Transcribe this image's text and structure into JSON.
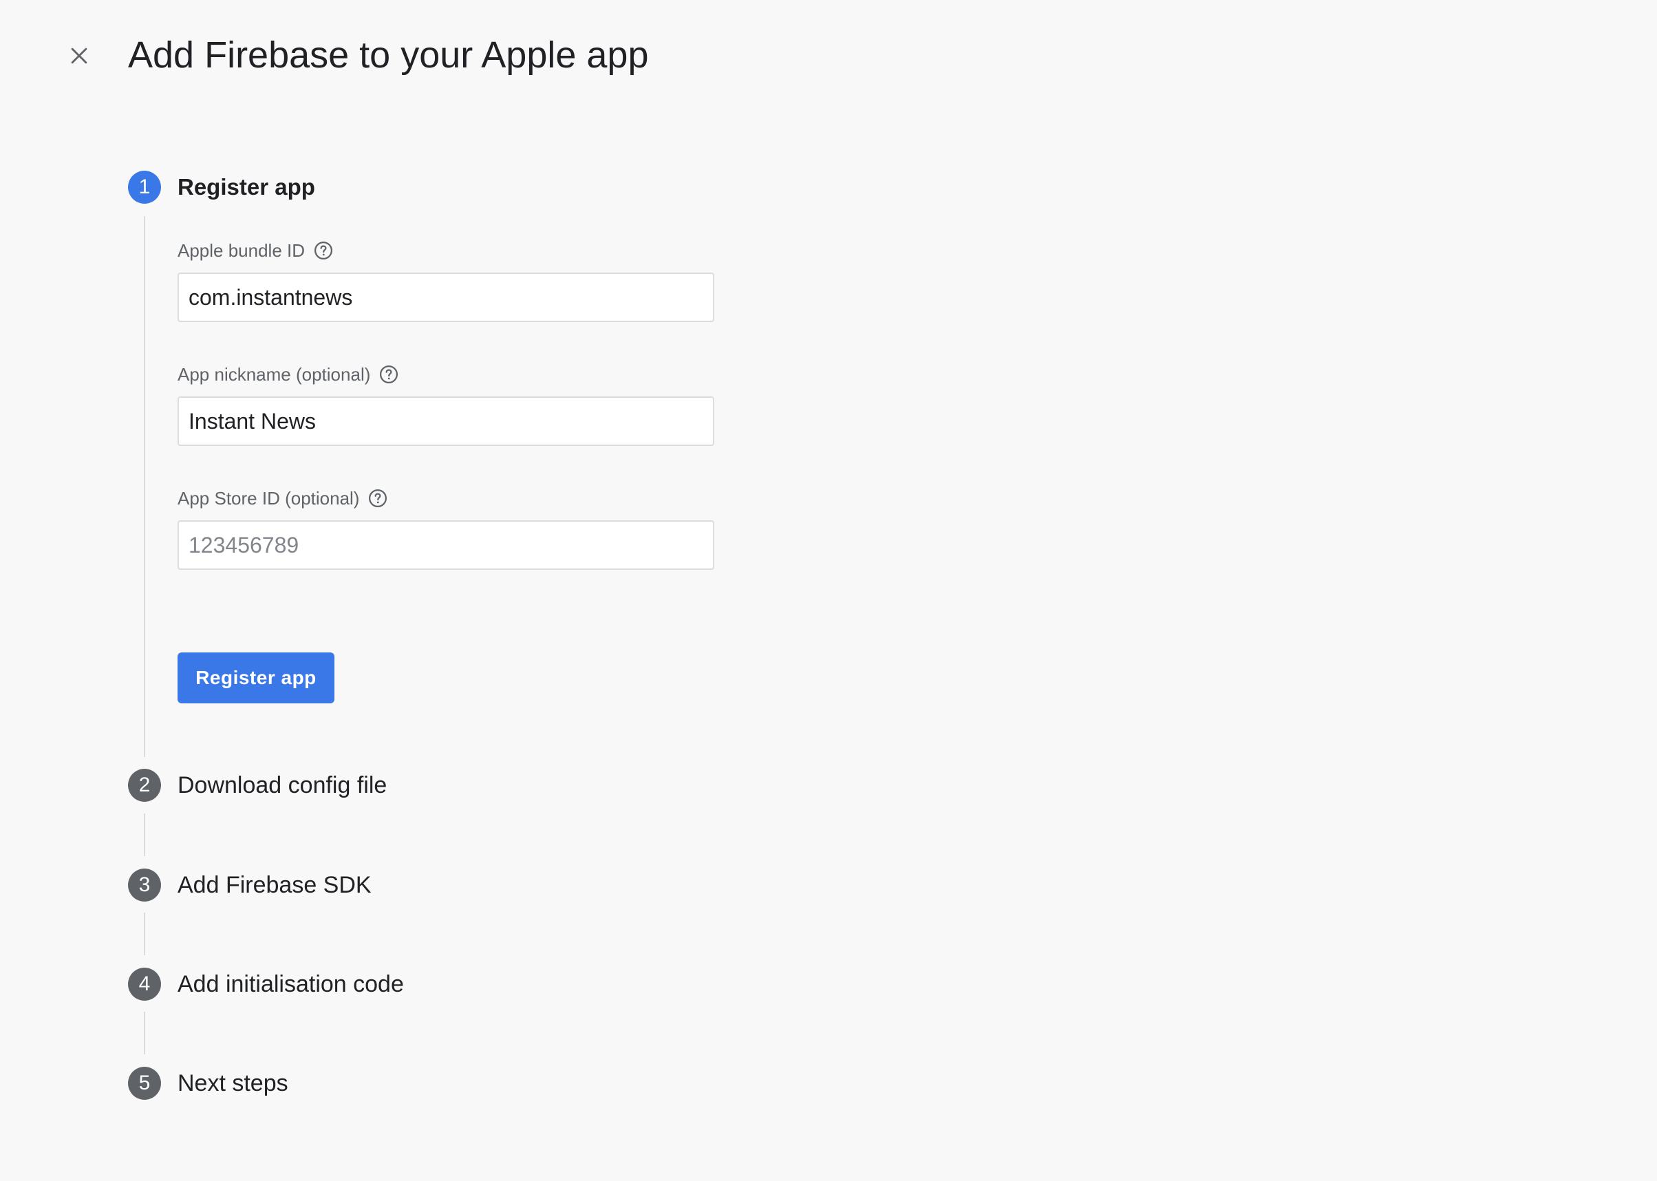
{
  "header": {
    "title": "Add Firebase to your Apple app"
  },
  "steps": [
    {
      "number": "1",
      "label": "Register app",
      "active": true
    },
    {
      "number": "2",
      "label": "Download config file",
      "active": false
    },
    {
      "number": "3",
      "label": "Add Firebase SDK",
      "active": false
    },
    {
      "number": "4",
      "label": "Add initialisation code",
      "active": false
    },
    {
      "number": "5",
      "label": "Next steps",
      "active": false
    }
  ],
  "form": {
    "bundle_id": {
      "label": "Apple bundle ID",
      "value": "com.instantnews",
      "placeholder": ""
    },
    "nickname": {
      "label": "App nickname (optional)",
      "value": "Instant News",
      "placeholder": ""
    },
    "app_store_id": {
      "label": "App Store ID (optional)",
      "value": "",
      "placeholder": "123456789"
    },
    "submit_label": "Register app"
  },
  "icons": {
    "close": "close-icon",
    "help": "help-circle-icon"
  },
  "colors": {
    "accent": "#3b78e7",
    "inactive_step": "#5f6368",
    "background": "#f8f8f8"
  }
}
